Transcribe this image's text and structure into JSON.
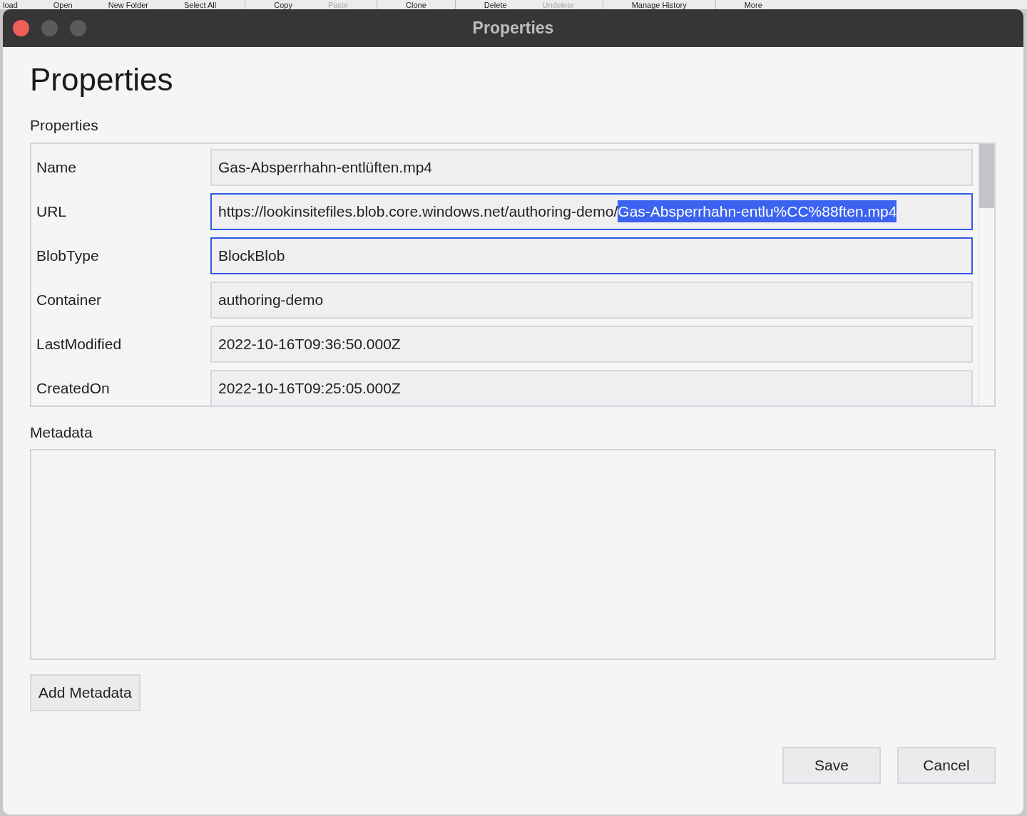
{
  "background_toolbar": [
    {
      "label": "load",
      "disabled": false
    },
    {
      "label": "Open",
      "disabled": false
    },
    {
      "label": "New Folder",
      "disabled": false
    },
    {
      "label": "Select All",
      "disabled": false
    },
    {
      "label": "Copy",
      "disabled": false
    },
    {
      "label": "Paste",
      "disabled": true
    },
    {
      "label": "Clone",
      "disabled": false
    },
    {
      "label": "Delete",
      "disabled": false
    },
    {
      "label": "Undelete",
      "disabled": true
    },
    {
      "label": "Manage History",
      "disabled": false
    },
    {
      "label": "More",
      "disabled": false
    }
  ],
  "window": {
    "title": "Properties"
  },
  "heading": "Properties",
  "properties": {
    "label": "Properties",
    "rows": [
      {
        "name": "Name",
        "focused": false,
        "value_parts": [
          {
            "text": "Gas-Absperrhahn-entlüften.mp4",
            "selected": false
          }
        ]
      },
      {
        "name": "URL",
        "focused": true,
        "value_parts": [
          {
            "text": "https://lookinsitefiles.blob.core.windows.net/authoring-demo/",
            "selected": false
          },
          {
            "text": "Gas-Absperrhahn-entlu%CC%88ften.mp4",
            "selected": true
          }
        ]
      },
      {
        "name": "BlobType",
        "focused": true,
        "value_parts": [
          {
            "text": "BlockBlob",
            "selected": false
          }
        ]
      },
      {
        "name": "Container",
        "focused": false,
        "value_parts": [
          {
            "text": "authoring-demo",
            "selected": false
          }
        ]
      },
      {
        "name": "LastModified",
        "focused": false,
        "value_parts": [
          {
            "text": "2022-10-16T09:36:50.000Z",
            "selected": false
          }
        ]
      },
      {
        "name": "CreatedOn",
        "focused": false,
        "value_parts": [
          {
            "text": "2022-10-16T09:25:05.000Z",
            "selected": false
          }
        ]
      }
    ]
  },
  "metadata": {
    "label": "Metadata"
  },
  "buttons": {
    "add": "Add Metadata",
    "save": "Save",
    "cancel": "Cancel"
  }
}
